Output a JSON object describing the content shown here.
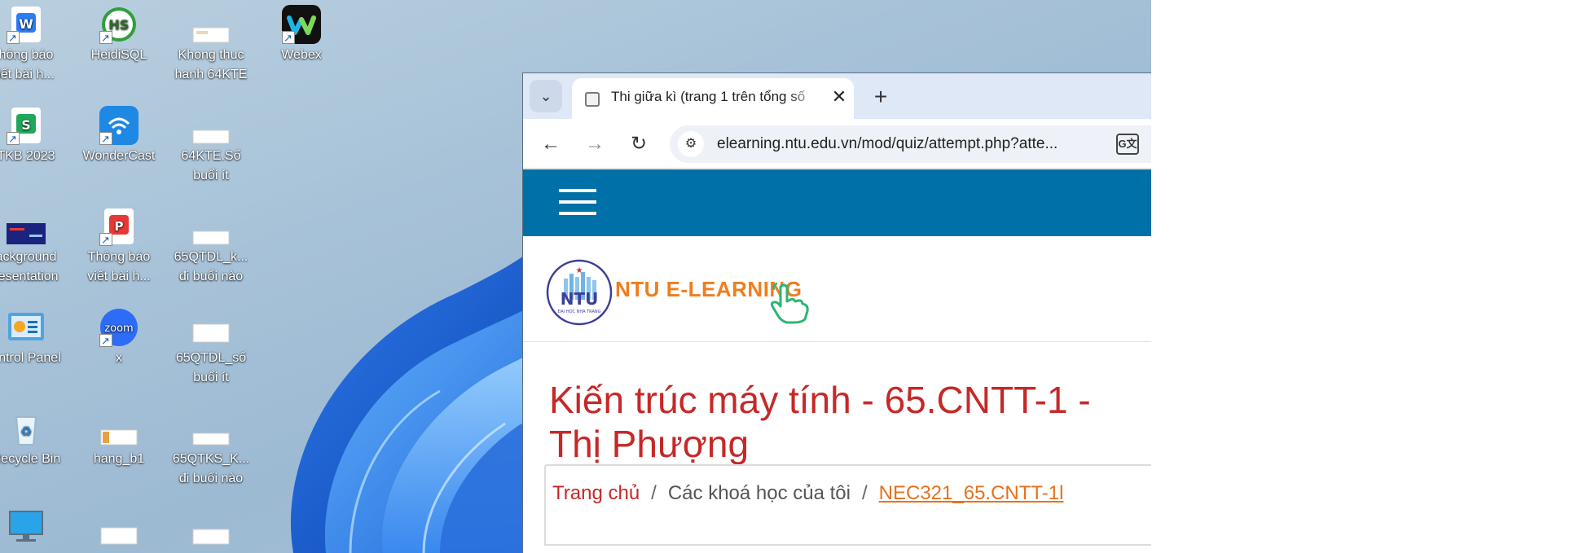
{
  "desktop": {
    "icons": [
      {
        "name": "wps-writer-doc",
        "label_line1": "hông báo",
        "label_line2": "iết bài h..."
      },
      {
        "name": "heidisql",
        "label_line1": "HeidiSQL",
        "label_line2": ""
      },
      {
        "name": "khong-thuc-hanh-file",
        "label_line1": "Khong thuc",
        "label_line2": "hanh 64KTE"
      },
      {
        "name": "webex",
        "label_line1": "Webex",
        "label_line2": ""
      },
      {
        "name": "wps-spreadsheet",
        "label_line1": "TKB 2023",
        "label_line2": ""
      },
      {
        "name": "wondercast",
        "label_line1": "WonderCast",
        "label_line2": ""
      },
      {
        "name": "64kte-file",
        "label_line1": "64KTE.Số",
        "label_line2": "buổi ít"
      },
      {
        "name": "background-presentation",
        "label_line1": "ackground",
        "label_line2": "resentation"
      },
      {
        "name": "wps-pdf",
        "label_line1": "Thông báo",
        "label_line2": "viết bài h..."
      },
      {
        "name": "65qtdl-k-file",
        "label_line1": "65QTDL_k...",
        "label_line2": "đi buổi nào"
      },
      {
        "name": "control-panel",
        "label_line1": "ontrol Panel",
        "label_line2": ""
      },
      {
        "name": "zoom",
        "label_line1": "x",
        "label_line2": ""
      },
      {
        "name": "65qtdl-so-file",
        "label_line1": "65QTDL_số",
        "label_line2": "buổi ít"
      },
      {
        "name": "recycle-bin",
        "label_line1": "Recycle Bin",
        "label_line2": ""
      },
      {
        "name": "hang-b1-file",
        "label_line1": "hang_b1",
        "label_line2": ""
      },
      {
        "name": "65qtks-k-file",
        "label_line1": "65QTKS_K...",
        "label_line2": "đi buổi nào"
      }
    ]
  },
  "browser": {
    "tab_title": "Thi giữa kì (trang 1 trên tổng số",
    "tab_close": "✕",
    "new_tab": "+",
    "tab_search": "⌄",
    "back": "←",
    "forward": "→",
    "reload": "↻",
    "url": "elearning.ntu.edu.vn/mod/quiz/attempt.php?atte...",
    "translate": "G文"
  },
  "page": {
    "logo_text": "NTU E-LEARNING",
    "logo_badge": "NTU",
    "logo_caption": "ĐẠI HỌC NHA TRANG",
    "course_title_line1": "Kiến trúc máy tính - 65.CNTT-1 -",
    "course_title_line2": "Thị Phượng",
    "breadcrumb": {
      "home": "Trang chủ",
      "separator": "/",
      "my_courses": "Các khoá học của tôi",
      "course": "NEC321_65.CNTT-1l"
    }
  },
  "colors": {
    "navbar": "#0070a8",
    "title": "#c62828",
    "logo_orange": "#f07d1e",
    "link_orange": "#e8711c"
  }
}
